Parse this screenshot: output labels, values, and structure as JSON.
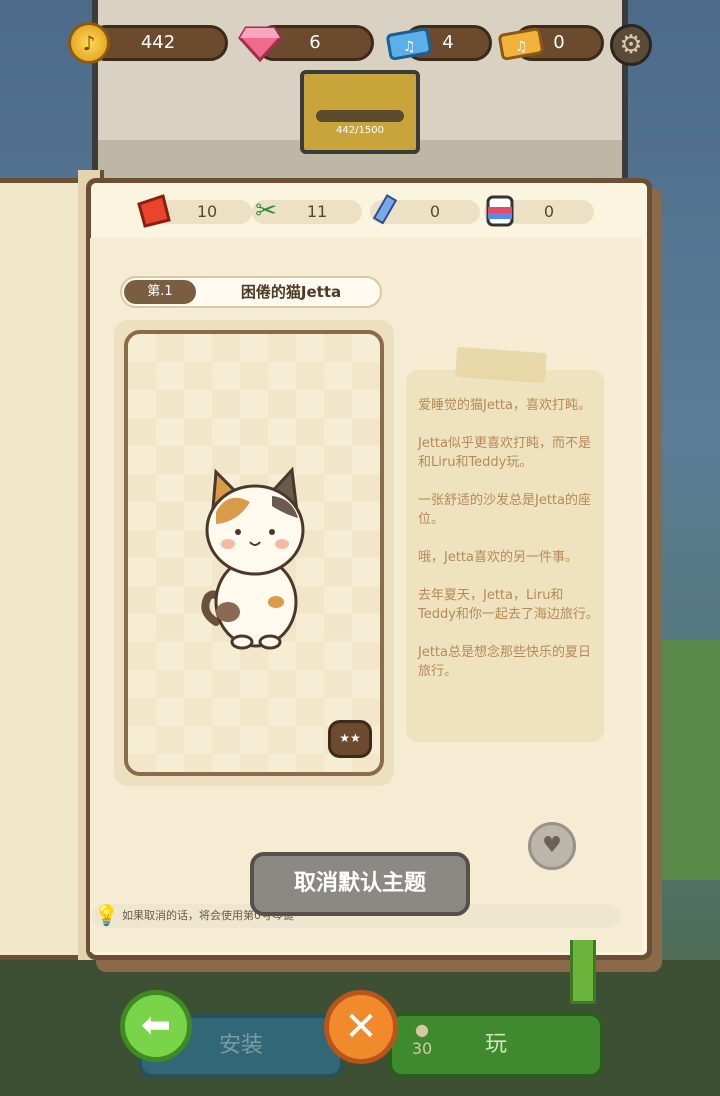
{
  "currency": {
    "coins": "442",
    "gems": "6",
    "blue_tickets": "4",
    "gold_tickets": "0"
  },
  "scene": {
    "lock_progress_text": "442/1500"
  },
  "resources": {
    "red_paper": "10",
    "scissors": "11",
    "pencil": "0",
    "paint": "0"
  },
  "chapter": {
    "number": "第.1",
    "title": "困倦的猫Jetta"
  },
  "story": {
    "paragraphs": [
      "爱睡觉的猫Jetta，喜欢打盹。",
      "Jetta似乎更喜欢打盹，而不是和Liru和Teddy玩。",
      "一张舒适的沙发总是Jetta的座位。",
      "哦，Jetta喜欢的另一件事。",
      "去年夏天，Jetta，Liru和Teddy和你一起去了海边旅行。",
      "Jetta总是想念那些快乐的夏日旅行。"
    ]
  },
  "unset_theme_label": "取消默认主题",
  "hint_text": "如果取消的话，将会使用第0号琴键",
  "bottom": {
    "install_label": "安装",
    "play_label": "玩",
    "play_cost": "30"
  },
  "colors": {
    "page": "#fbf4df",
    "border": "#6b4f35",
    "accent_green": "#7ad44a",
    "accent_orange": "#f08a2a"
  }
}
